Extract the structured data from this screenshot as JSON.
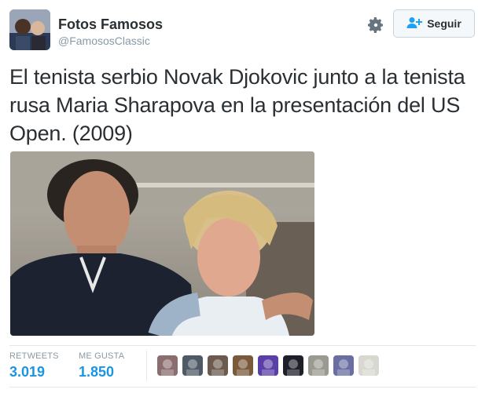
{
  "user": {
    "name": "Fotos Famosos",
    "handle": "@FamososClassic"
  },
  "follow_button": {
    "label": "Seguir"
  },
  "tweet": {
    "text": "El tenista serbio Novak Djokovic junto a la tenista rusa Maria Sharapova en la presentación del US Open. (2009)"
  },
  "stats": {
    "retweets_label": "RETWEETS",
    "retweets_value": "3.019",
    "likes_label": "ME GUSTA",
    "likes_value": "1.850"
  },
  "liker_avatar_colors": [
    "#8a6d6f",
    "#4f5a66",
    "#6b5a4d",
    "#7a5a3a",
    "#5b3fa8",
    "#1f1f2a",
    "#9a9a90",
    "#6a6ea0",
    "#d8d8d0"
  ],
  "icons": {
    "gear": "gear-icon",
    "follow": "add-user-icon"
  }
}
